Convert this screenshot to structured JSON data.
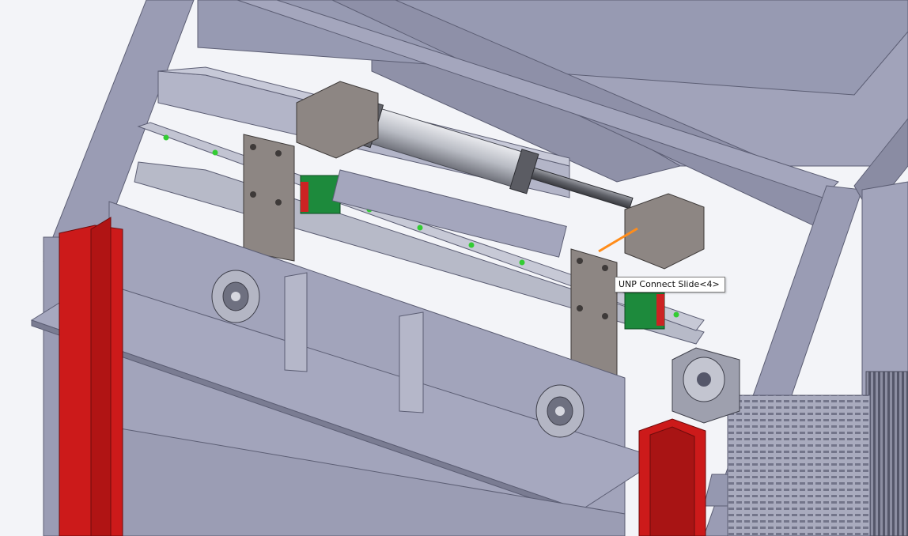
{
  "viewport": {
    "background": "#f3f4f8",
    "frame_color": "#9a9cb4",
    "frame_edge_color": "#5c5e74",
    "plate_color": "#a4a6bd",
    "rail_color": "#b8bbc9",
    "rail_marker_color": "#33cc33",
    "bracket_color": "#8d8683",
    "slider_block_color": "#1d8a3c",
    "slider_accent_color": "#cc2323",
    "red_post_color": "#cc1a1a",
    "highlight_color": "#ff8c1a"
  },
  "tooltip": {
    "text": "UNP Connect Slide<4>"
  }
}
